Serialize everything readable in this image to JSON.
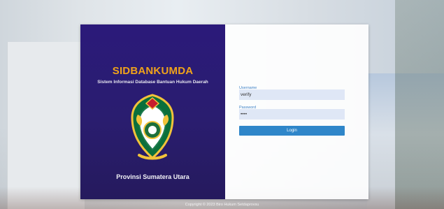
{
  "app": {
    "title": "SIDBANKUMDA",
    "subtitle": "Sistem Informasi Database Bantuan Hukum Daerah",
    "province": "Provinsi Sumatera Utara"
  },
  "form": {
    "username_label": "Username",
    "username_value": "verify",
    "password_label": "Password",
    "password_value": "••••",
    "login_label": "Login"
  },
  "footer": {
    "copyright": "Copyright © 2023 Biro Hukum Setdaprovsu"
  },
  "colors": {
    "brand_panel": "#2b1a7a",
    "title_accent": "#f0a31a",
    "button": "#2f86c9",
    "input_bg": "#dfe7f6"
  },
  "icons": {
    "emblem": "provincial-emblem"
  }
}
